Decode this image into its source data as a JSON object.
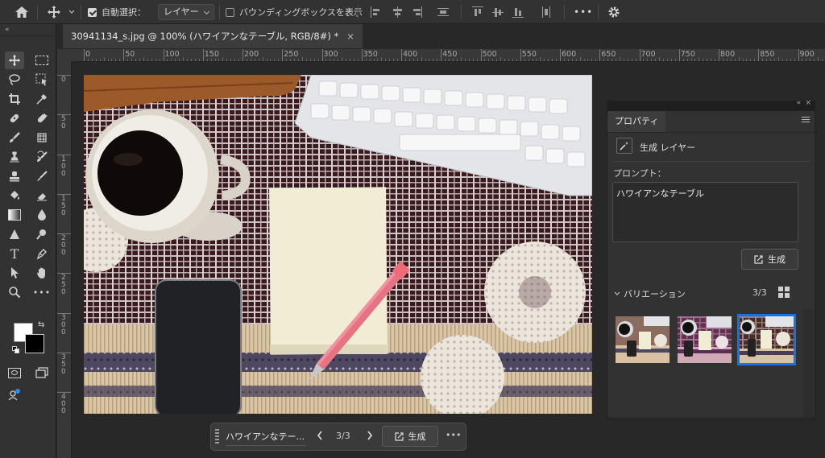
{
  "optionsbar": {
    "auto_select_label": "自動選択：",
    "auto_select_checked": true,
    "auto_select_target": "レイヤー",
    "bounding_box_label": "バウンディングボックスを表示",
    "bounding_box_checked": false
  },
  "document": {
    "tab_title": "30941134_s.jpg @ 100% (ハワイアンなテーブル, RGB/8#) *",
    "close_symbol": "×"
  },
  "ruler": {
    "h_ticks": [
      "0",
      "50",
      "100",
      "150",
      "200",
      "250",
      "300",
      "350",
      "400",
      "450",
      "500",
      "550",
      "600",
      "650",
      "700",
      "750",
      "800",
      "850",
      "900"
    ],
    "v_ticks": [
      "0",
      "50",
      "100",
      "150",
      "200",
      "250",
      "300",
      "350",
      "400"
    ]
  },
  "properties": {
    "tab_label": "プロパティ",
    "layer_type": "生成 レイヤー",
    "prompt_label": "プロンプト：",
    "prompt_value": "ハワイアンなテーブル",
    "generate_label": "生成",
    "variations_label": "バリエーション",
    "variations_count": "3/3",
    "selected_variation": 3
  },
  "taskbar": {
    "prompt_value": "ハワイアンなテー...",
    "counter": "3/3",
    "generate_label": "生成",
    "more_symbol": "•••"
  },
  "colors": {
    "panel_bg": "#323232",
    "canvas_bg": "#282828",
    "selection_blue": "#1473e6"
  }
}
